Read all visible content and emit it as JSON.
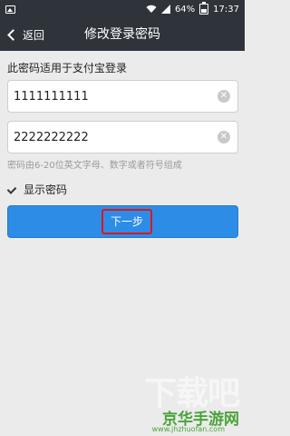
{
  "status_bar": {
    "battery": "64%",
    "time": "17:37"
  },
  "nav": {
    "back_label": "返回",
    "title": "修改登录密码"
  },
  "form": {
    "hint": "此密码适用于支付宝登录",
    "password1_value": "1111111111",
    "password2_value": "2222222222",
    "rule": "密码由6-20位英文字母、数字或者符号组成",
    "show_password_label": "显示密码",
    "show_password_checked": true,
    "next_label": "下一步"
  },
  "watermark": {
    "logo_text": "下载吧",
    "site_name": "京华手游网",
    "site_url": "www.jhzhuofan.com"
  },
  "colors": {
    "bar": "#2f343b",
    "background": "#ebebeb",
    "button": "#2d8de6",
    "highlight": "#e0161b",
    "watermark_green": "#4aa33a"
  }
}
